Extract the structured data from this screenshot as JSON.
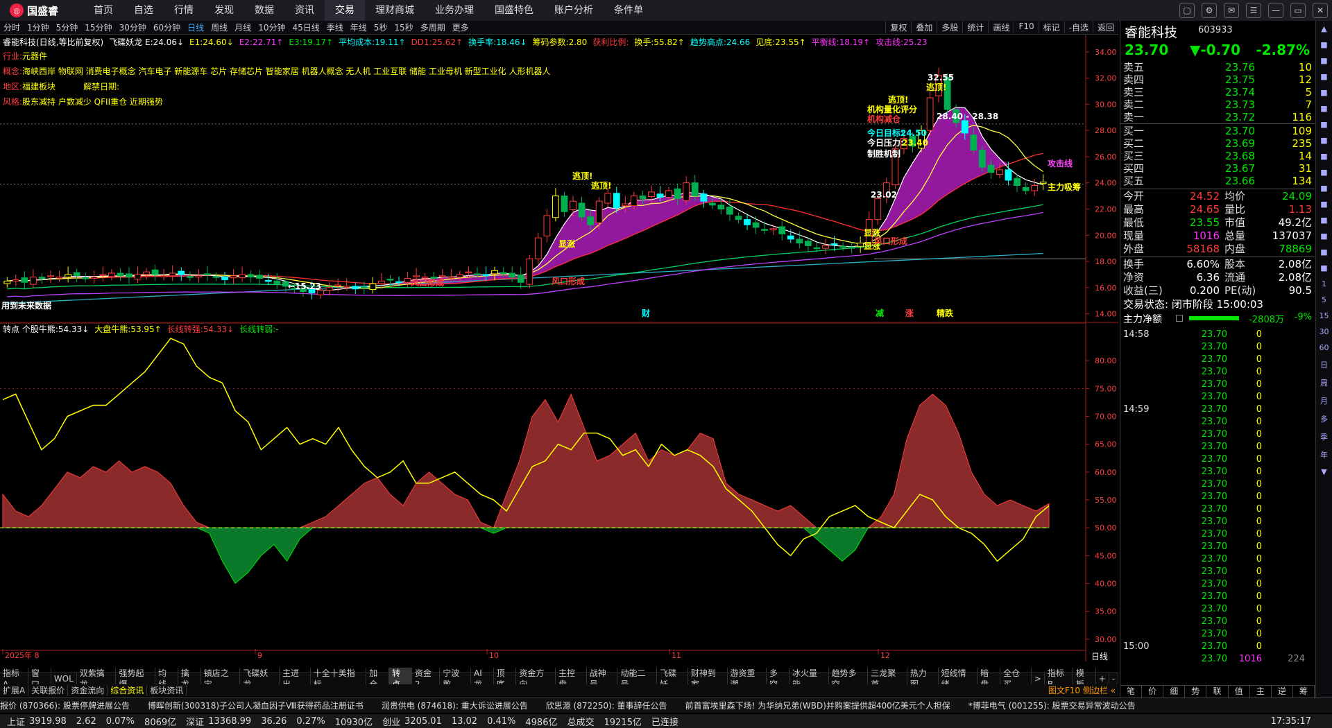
{
  "colors": {
    "up": "#ff3b3b",
    "down": "#00e600",
    "yellow": "#ffff00",
    "cyan": "#00ffff",
    "magenta": "#ff44ff",
    "band": "#9a1aa6"
  },
  "app": {
    "logo": "国盛睿",
    "nav": [
      "首页",
      "自选",
      "行情",
      "发现",
      "数据",
      "资讯",
      "交易",
      "理财商城",
      "业务办理",
      "国盛特色",
      "账户分析",
      "条件单"
    ],
    "active_nav": "交易",
    "window_controls": [
      "▢",
      "⚙",
      "✉",
      "☰",
      "—",
      "▭",
      "✕"
    ]
  },
  "periods": {
    "items": [
      "分时",
      "1分钟",
      "5分钟",
      "15分钟",
      "30分钟",
      "60分钟",
      "日线",
      "周线",
      "月线",
      "10分钟",
      "45日线",
      "季线",
      "年线",
      "5秒",
      "15秒",
      "多周期",
      "更多"
    ],
    "active": "日线",
    "tools": [
      "复权",
      "叠加",
      "多股",
      "统计",
      "画线",
      "F10",
      "标记",
      "-自选",
      "返回"
    ]
  },
  "main": {
    "header": [
      {
        "t": "睿能科技(日线,等比前复权)",
        "c": "wht"
      },
      {
        "t": "飞碟妖龙 E:24.06↓",
        "c": "wht"
      },
      {
        "t": "E1:24.60↓",
        "c": "yel"
      },
      {
        "t": "E2:22.71↑",
        "c": "mag"
      },
      {
        "t": "E3:19.17↑",
        "c": "grn"
      },
      {
        "t": "平均成本:19.11↑",
        "c": "cyn"
      },
      {
        "t": "DD1:25.62↑",
        "c": "red"
      },
      {
        "t": "换手率:18.46↓",
        "c": "cyn"
      },
      {
        "t": "筹码参数:2.80",
        "c": "yel"
      },
      {
        "t": "获利比例:",
        "c": "red"
      },
      {
        "t": "换手:55.82↑",
        "c": "yel"
      },
      {
        "t": "趋势高点:24.66",
        "c": "cyn"
      },
      {
        "t": "见底:23.55↑",
        "c": "yel"
      },
      {
        "t": "平衡线:18.19↑",
        "c": "mag"
      },
      {
        "t": "攻击线:25.23",
        "c": "mag"
      }
    ],
    "info": [
      {
        "k": "行业:",
        "v": "元器件"
      },
      {
        "k": "概念:",
        "v": "海峡西岸 物联网 消费电子概念 汽车电子 新能源车 芯片 存储芯片 智能家居 机器人概念 无人机 工业互联 储能 工业母机 新型工业化 人形机器人"
      },
      {
        "k": "地区:",
        "v": "福建板块",
        "k2": "解禁日期:",
        "v2": ""
      },
      {
        "k": "风格:",
        "v": "股东减持 户数减少 QFII重仓 近期强势"
      }
    ],
    "yticks": [
      "34.00",
      "32.00",
      "30.00",
      "28.00",
      "26.00",
      "24.00",
      "22.00",
      "20.00",
      "18.00",
      "16.00",
      "14.00"
    ],
    "annotations": [
      {
        "t": "32.55",
        "c": "wht"
      },
      {
        "t": "逃顶!",
        "c": "yel"
      },
      {
        "t": "逃顶!",
        "c": "yel"
      },
      {
        "t": "机构量化评分",
        "c": "yel"
      },
      {
        "t": "机构减仓",
        "c": "red"
      },
      {
        "t": "今日目标:",
        "c": "cyn"
      },
      {
        "t": "24.50",
        "c": "cyn"
      },
      {
        "t": "今日压力:",
        "c": "wht"
      },
      {
        "t": "23.40",
        "c": "yel"
      },
      {
        "t": "制胜机制",
        "c": "wht"
      },
      {
        "t": "28.40 - 28.38",
        "c": "wht"
      },
      {
        "t": "攻击线",
        "c": "mag"
      },
      {
        "t": "主力吸筹",
        "c": "yel"
      },
      {
        "t": "逃顶!",
        "c": "yel"
      },
      {
        "t": "逃顶!",
        "c": "yel"
      },
      {
        "t": "显涨",
        "c": "yel"
      },
      {
        "t": "显涨",
        "c": "yel"
      },
      {
        "t": "显涨",
        "c": "yel"
      },
      {
        "t": "风口形成",
        "c": "red"
      },
      {
        "t": "风口形成",
        "c": "red"
      },
      {
        "t": "风口形成",
        "c": "red"
      },
      {
        "t": "←15.23",
        "c": "wht"
      },
      {
        "t": "23.02",
        "c": "wht"
      },
      {
        "t": "用到未来数据",
        "c": "wht"
      },
      {
        "t": "财",
        "c": "cyn"
      },
      {
        "t": "减",
        "c": "grn"
      },
      {
        "t": "涨",
        "c": "red"
      },
      {
        "t": "精跌",
        "c": "yel"
      }
    ]
  },
  "sub": {
    "header": [
      {
        "t": "转点 个股牛熊:54.33↓",
        "c": "wht"
      },
      {
        "t": "大盘牛熊:53.95↑",
        "c": "yel"
      },
      {
        "t": "长线转强:54.33↓",
        "c": "red"
      },
      {
        "t": "长线转弱:-",
        "c": "grn"
      }
    ],
    "yticks": [
      "80.00",
      "75.00",
      "70.00",
      "65.00",
      "60.00",
      "55.00",
      "50.00",
      "45.00",
      "40.00",
      "35.00",
      "30.00"
    ],
    "xlabels": [
      "2025年 8",
      "9",
      "10",
      "11",
      "12"
    ],
    "period_label": "日线"
  },
  "chart_data": [
    {
      "type": "candlestick",
      "title": "睿能科技(日线,等比前复权)",
      "ylim": [
        13.5,
        35
      ],
      "y_ticks": [
        14,
        16,
        18,
        20,
        22,
        24,
        26,
        28,
        30,
        32,
        34
      ],
      "closes": [
        16.5,
        16.6,
        16.4,
        16.8,
        16.7,
        16.9,
        16.8,
        17.0,
        16.9,
        16.7,
        16.8,
        17.0,
        17.1,
        16.9,
        16.8,
        17.0,
        17.2,
        17.0,
        16.9,
        17.1,
        17.0,
        16.8,
        16.9,
        17.0,
        16.8,
        16.6,
        16.9,
        17.0,
        16.8,
        16.7,
        16.5,
        16.3,
        16.1,
        15.9,
        15.7,
        15.6,
        15.8,
        16.0,
        16.2,
        16.1,
        15.9,
        16.0,
        16.3,
        16.5,
        16.6,
        16.4,
        16.7,
        16.9,
        16.8,
        16.7,
        16.9,
        16.8,
        17.0,
        17.2,
        17.0,
        16.9,
        17.3,
        17.1,
        16.8,
        16.4,
        18.2,
        19.8,
        21.5,
        23.0,
        21.8,
        22.6,
        21.4,
        20.8,
        22.6,
        23.2,
        22.1,
        22.4,
        23.0,
        22.8,
        23.3,
        22.9,
        23.4,
        22.8,
        24.0,
        23.0,
        22.6,
        22.3,
        22.0,
        21.6,
        21.2,
        20.8,
        20.6,
        20.4,
        20.5,
        20.1,
        19.7,
        19.4,
        19.2,
        19.0,
        19.2,
        19.3,
        19.1,
        19.0,
        19.4,
        21.2,
        22.8,
        24.0,
        26.6,
        27.4,
        26.8,
        28.0,
        30.5,
        32.2,
        29.6,
        28.6,
        27.8,
        26.5,
        25.2,
        24.8,
        25.0,
        24.2,
        23.8,
        23.4,
        23.8,
        24.06
      ]
    },
    {
      "type": "area",
      "title": "转点",
      "ylim": [
        26,
        86
      ],
      "y_ticks": [
        30,
        35,
        40,
        45,
        50,
        55,
        60,
        65,
        70,
        75,
        80
      ],
      "baseline": 50,
      "series": [
        {
          "name": "个股牛熊",
          "values": [
            56,
            53,
            52,
            54,
            57,
            60,
            59,
            61,
            60,
            62,
            60,
            61,
            60,
            58,
            54,
            51,
            49,
            44,
            40,
            42,
            45,
            47,
            44,
            48,
            51,
            52,
            54,
            56,
            58,
            59,
            56,
            54,
            58,
            60,
            58,
            56,
            55,
            51,
            49,
            56,
            62,
            70,
            73,
            69,
            74,
            68,
            62,
            63,
            65,
            67,
            62,
            64,
            63,
            64,
            67,
            66,
            58,
            56,
            55,
            54,
            53,
            54,
            52,
            48,
            46,
            44,
            46,
            50,
            52,
            56,
            66,
            72,
            74,
            72,
            67,
            60,
            56,
            54,
            55,
            54,
            53,
            54.33
          ]
        },
        {
          "name": "大盘牛熊",
          "values": [
            73,
            74,
            69,
            64,
            66,
            70,
            71,
            72,
            72,
            74,
            76,
            78,
            81,
            84,
            83,
            79,
            77,
            76,
            71,
            69,
            64,
            66,
            68,
            65,
            66,
            65,
            68,
            64,
            61,
            59,
            60,
            62,
            58,
            58,
            59,
            60,
            58,
            56,
            55,
            53,
            57,
            61,
            62,
            65,
            64,
            67,
            67,
            66,
            63,
            64,
            61,
            65,
            63,
            64,
            63,
            61,
            57,
            55,
            53,
            50,
            47,
            45,
            48,
            49,
            52,
            53,
            54,
            52,
            51,
            50,
            53,
            56,
            55,
            52,
            50,
            49,
            47,
            44,
            46,
            48,
            52,
            53.95
          ]
        }
      ]
    }
  ],
  "right": {
    "name": "睿能科技",
    "code": "603933",
    "price": "23.70",
    "chg": "▼-0.70",
    "pct": "-2.87%",
    "asks": [
      {
        "l": "卖五",
        "p": "23.76",
        "v": "10"
      },
      {
        "l": "卖四",
        "p": "23.75",
        "v": "12"
      },
      {
        "l": "卖三",
        "p": "23.74",
        "v": "5"
      },
      {
        "l": "卖二",
        "p": "23.73",
        "v": "7"
      },
      {
        "l": "卖一",
        "p": "23.72",
        "v": "116"
      }
    ],
    "bids": [
      {
        "l": "买一",
        "p": "23.70",
        "v": "109"
      },
      {
        "l": "买二",
        "p": "23.69",
        "v": "235"
      },
      {
        "l": "买三",
        "p": "23.68",
        "v": "14"
      },
      {
        "l": "买四",
        "p": "23.67",
        "v": "31"
      },
      {
        "l": "买五",
        "p": "23.66",
        "v": "134"
      }
    ],
    "quote": [
      {
        "l1": "今开",
        "v1": "24.52",
        "c1": "red",
        "l2": "均价",
        "v2": "24.09",
        "c2": "grn"
      },
      {
        "l1": "最高",
        "v1": "24.65",
        "c1": "red",
        "l2": "量比",
        "v2": "1.13",
        "c2": "red"
      },
      {
        "l1": "最低",
        "v1": "23.55",
        "c1": "grn",
        "l2": "市值",
        "v2": "49.2亿",
        "c2": "wht"
      },
      {
        "l1": "现量",
        "v1": "1016",
        "c1": "mag",
        "l2": "总量",
        "v2": "137037",
        "c2": "wht"
      },
      {
        "l1": "外盘",
        "v1": "58168",
        "c1": "red",
        "l2": "内盘",
        "v2": "78869",
        "c2": "grn"
      }
    ],
    "quote2": [
      {
        "l1": "换手",
        "v1": "6.60%",
        "l2": "股本",
        "v2": "2.08亿"
      },
      {
        "l1": "净资",
        "v1": "6.36",
        "l2": "流通",
        "v2": "2.08亿"
      },
      {
        "l1": "收益(三)",
        "v1": "0.200",
        "l2": "PE(动)",
        "v2": "90.5"
      }
    ],
    "status": "交易状态: 闭市阶段 15:00:03",
    "netflow": {
      "label": "主力净额",
      "value": "-2808万",
      "pct": "-9%",
      "ratio": 0.45
    },
    "ticks": [
      {
        "t": "14:58",
        "p": "23.70",
        "v": "0"
      },
      {
        "t": "",
        "p": "23.70",
        "v": "0"
      },
      {
        "t": "",
        "p": "23.70",
        "v": "0"
      },
      {
        "t": "",
        "p": "23.70",
        "v": "0"
      },
      {
        "t": "",
        "p": "23.70",
        "v": "0"
      },
      {
        "t": "",
        "p": "23.70",
        "v": "0"
      },
      {
        "t": "14:59",
        "p": "23.70",
        "v": "0"
      },
      {
        "t": "",
        "p": "23.70",
        "v": "0"
      },
      {
        "t": "",
        "p": "23.70",
        "v": "0"
      },
      {
        "t": "",
        "p": "23.70",
        "v": "0"
      },
      {
        "t": "",
        "p": "23.70",
        "v": "0"
      },
      {
        "t": "",
        "p": "23.70",
        "v": "0"
      },
      {
        "t": "",
        "p": "23.70",
        "v": "0"
      },
      {
        "t": "",
        "p": "23.70",
        "v": "0"
      },
      {
        "t": "",
        "p": "23.70",
        "v": "0"
      },
      {
        "t": "",
        "p": "23.70",
        "v": "0"
      },
      {
        "t": "",
        "p": "23.70",
        "v": "0"
      },
      {
        "t": "",
        "p": "23.70",
        "v": "0"
      },
      {
        "t": "",
        "p": "23.70",
        "v": "0"
      },
      {
        "t": "",
        "p": "23.70",
        "v": "0"
      },
      {
        "t": "",
        "p": "23.70",
        "v": "0"
      },
      {
        "t": "",
        "p": "23.70",
        "v": "0"
      },
      {
        "t": "",
        "p": "23.70",
        "v": "0"
      },
      {
        "t": "",
        "p": "23.70",
        "v": "0"
      },
      {
        "t": "",
        "p": "23.70",
        "v": "0"
      },
      {
        "t": "15:00",
        "p": "23.70",
        "v": "0"
      },
      {
        "t": "",
        "p": "23.70",
        "v": "1016",
        "z": "224"
      }
    ],
    "bottom_tabs": [
      "笔",
      "价",
      "细",
      "势",
      "联",
      "值",
      "主",
      "逆",
      "筹"
    ]
  },
  "sidebar": [
    "▲",
    "■",
    "■",
    "■",
    "■",
    "■",
    "■",
    "■",
    "■",
    "■",
    "■",
    "■",
    "■",
    "■",
    "■",
    "■",
    "1",
    "5",
    "15",
    "30",
    "60",
    "日",
    "周",
    "月",
    "多",
    "季",
    "年",
    "▼"
  ],
  "tabs1": [
    "指标A",
    "窗口",
    "WOL",
    "双紫擒龙",
    "强势起爆",
    "均线",
    "擒龙",
    "镇店之宝",
    "飞碟妖龙",
    "主进出",
    "十全十美指标",
    "加仓",
    "转点",
    "资金2",
    "宁波敢",
    "AI龙",
    "顶底",
    "资金方向",
    "主控盘",
    "战神号",
    "动能二号",
    "飞碟妖",
    "财神到家",
    "游资重潮",
    "多空",
    "冰火量能",
    "趋势多空",
    "三龙聚首",
    "热力图",
    "短线情绪",
    "暗盘",
    "全仓买",
    ">",
    "指标B",
    "模板",
    "+",
    "-"
  ],
  "tabs1_active": "转点",
  "tabs2": [
    "扩展A",
    "关联报价",
    "资金流向",
    "综合资讯",
    "板块资讯"
  ],
  "tabs2_active": "综合资讯",
  "tabs2_right": "图文F10 侧边栏 «",
  "ticker": [
    "报价 (870366): 股票停牌进展公告",
    "博晖创新(300318)子公司人凝血因子Ⅷ获得药品注册证书",
    "润贵供电 (874618): 重大诉讼进展公告",
    "欣思源 (872250): 董事辞任公告",
    "前首富埃里森下场! 为华纳兄弟(WBD)并购案提供超400亿美元个人担保",
    "*博菲电气 (001255): 股票交易异常波动公告"
  ],
  "status_bar": {
    "indices": [
      {
        "name": "上证",
        "val": "3919.98",
        "chg": "2.62",
        "pct": "0.07%",
        "amt": "8069亿"
      },
      {
        "name": "深证",
        "val": "13368.99",
        "chg": "36.26",
        "pct": "0.27%",
        "amt": "10930亿"
      },
      {
        "name": "创业",
        "val": "3205.01",
        "chg": "13.02",
        "pct": "0.41%",
        "amt": "4986亿"
      }
    ],
    "total_label": "总成交",
    "total": "19215亿",
    "conn": "已连接",
    "time": "17:35:17"
  }
}
